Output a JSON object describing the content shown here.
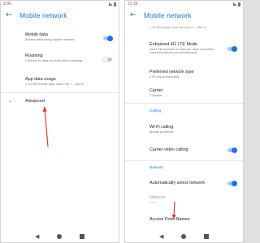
{
  "left_screen": {
    "status_time": "9:36",
    "title": "Mobile network",
    "items": [
      {
        "title": "Mobile data",
        "subtitle": "Access data using mobile network",
        "toggle": "on"
      },
      {
        "title": "Roaming",
        "subtitle": "Connect to data services when roaming",
        "toggle": "off"
      },
      {
        "title": "App data usage",
        "subtitle": "1.13 GB mobile data used Feb 7 – Mar 6"
      }
    ],
    "advanced_label": "Advanced"
  },
  "right_screen": {
    "status_time": "12:35",
    "title": "Mobile network",
    "top_cut_text": "1.13 GB mobile data used Feb 7 – Mar 6",
    "items": [
      {
        "title": "Enhanced 4G LTE Mode",
        "subtitle": "Use LTE services to improve voice and other communications (recommended)",
        "toggle": "on"
      },
      {
        "title": "Preferred network type",
        "subtitle": "LTE (recommended)"
      },
      {
        "title": "Carrier",
        "subtitle": "T-Mobile"
      }
    ],
    "calling_header": "Calling",
    "calling_items": [
      {
        "title": "Wi-Fi calling",
        "subtitle": "Mobile preferred"
      },
      {
        "title": "Carrier video calling",
        "toggle": "on"
      }
    ],
    "network_header": "Network",
    "network_items": [
      {
        "title": "Automatically select network",
        "toggle": "on"
      },
      {
        "title": "Network",
        "subtitle": "Auto"
      }
    ],
    "apn_label": "Access Point Names"
  },
  "colors": {
    "accent": "#1a73e8",
    "annotation_arrow": "#e53935"
  },
  "icons": {
    "back": "arrow-back-icon",
    "expand": "chevron-down-icon",
    "nav_back": "triangle-back-icon",
    "nav_home": "circle-home-icon",
    "nav_recents": "square-recents-icon"
  }
}
